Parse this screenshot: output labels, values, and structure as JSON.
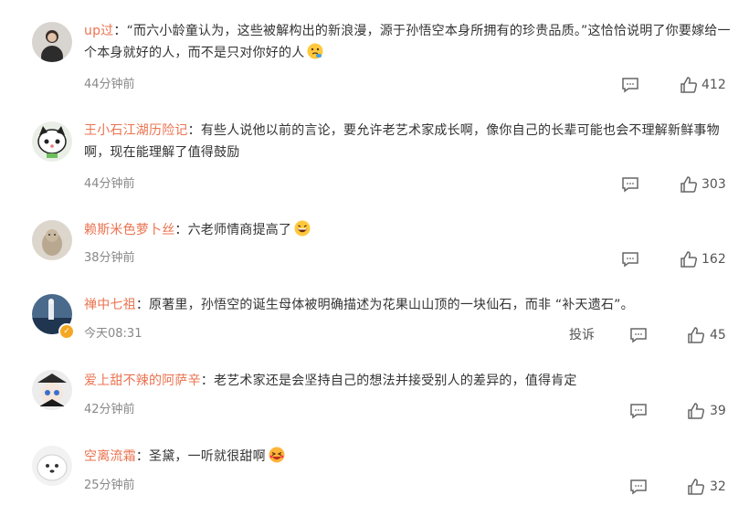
{
  "comments": [
    {
      "username": "up过",
      "separator": "：",
      "text": "“而六小龄童认为，这些被解构出的新浪漫，源于孙悟空本身所拥有的珍贵品质。”这恰恰说明了你要嫁给一个本身就好的人，而不是只对你好的人",
      "emoji": "thinking-face-emoji",
      "time": "44分钟前",
      "likes": "412",
      "verified": false,
      "report": ""
    },
    {
      "username": "王小石江湖历险记",
      "separator": "：",
      "text": "有些人说他以前的言论，要允许老艺术家成长啊，像你自己的长辈可能也会不理解新鲜事物啊，现在能理解了值得鼓励",
      "emoji": "",
      "time": "44分钟前",
      "likes": "303",
      "verified": false,
      "report": ""
    },
    {
      "username": "赖斯米色萝卜丝",
      "separator": "：",
      "text": "六老师情商提高了",
      "emoji": "grinning-face-emoji",
      "time": "38分钟前",
      "likes": "162",
      "verified": false,
      "report": ""
    },
    {
      "username": "禅中七祖",
      "separator": "：",
      "text": "原著里，孙悟空的诞生母体被明确描述为花果山山顶的一块仙石，而非 “补天遗石”。",
      "emoji": "",
      "time": "今天08:31",
      "likes": "45",
      "verified": true,
      "report": "投诉"
    },
    {
      "username": "爱上甜不辣的阿萨辛",
      "separator": "：",
      "text": "老艺术家还是会坚持自己的想法并接受别人的差异的，值得肯定",
      "emoji": "",
      "time": "42分钟前",
      "likes": "39",
      "verified": false,
      "report": ""
    },
    {
      "username": "空离流霜",
      "separator": "：",
      "text": "圣黛，一听就很甜啊",
      "emoji": "laughing-face-emoji",
      "time": "25分钟前",
      "likes": "32",
      "verified": false,
      "report": ""
    }
  ],
  "icons": {
    "reply": "comment-icon",
    "like": "thumbs-up-icon"
  },
  "colors": {
    "username": "#eb7350",
    "time": "#888888",
    "text": "#333333"
  }
}
